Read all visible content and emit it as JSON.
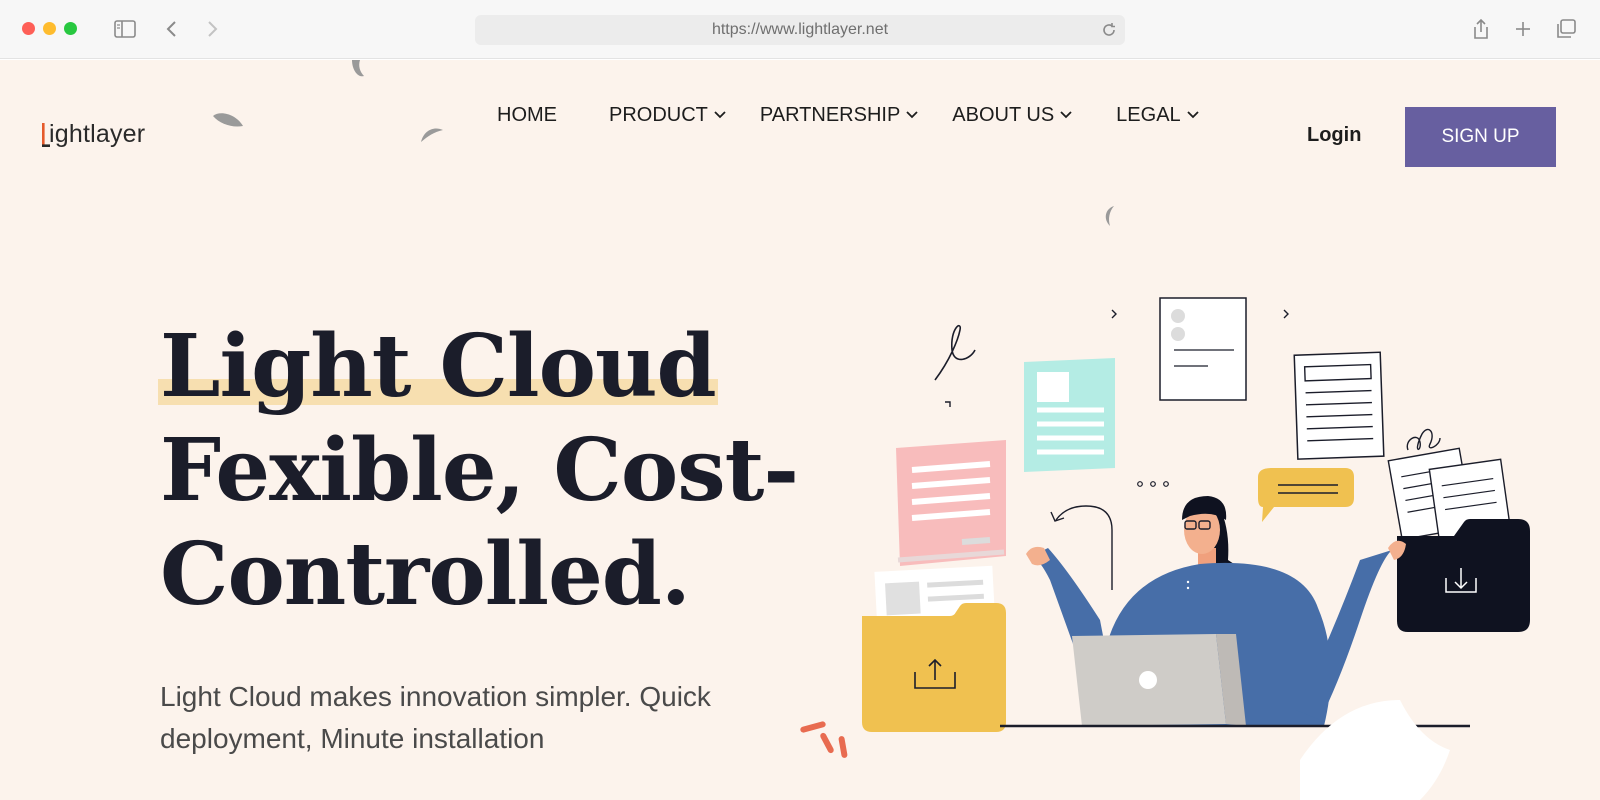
{
  "browser": {
    "url": "https://www.lightlayer.net",
    "icons": [
      "sidebar-icon",
      "back-icon",
      "forward-icon",
      "reload-icon",
      "share-icon",
      "new-tab-icon",
      "tabs-overview-icon"
    ]
  },
  "brand": {
    "logo_text": "lightlayer",
    "accent": "#e55a2b"
  },
  "nav": {
    "items": [
      {
        "label": "HOME",
        "has_dropdown": false
      },
      {
        "label": "PRODUCT",
        "has_dropdown": true
      },
      {
        "label": "PARTNERSHIP",
        "has_dropdown": true
      },
      {
        "label": "ABOUT US",
        "has_dropdown": true
      },
      {
        "label": "LEGAL",
        "has_dropdown": true
      }
    ],
    "login_label": "Login",
    "signup_label": "SIGN UP",
    "signup_color": "#675fa0"
  },
  "hero": {
    "title_line1": "Light Cloud",
    "title_line2": "Fexible, Cost-",
    "title_line3": "Controlled.",
    "subtitle": "Light Cloud makes innovation simpler. Quick deployment, Minute installation",
    "highlight_color": "#f7dfb0",
    "background": "#fcf3ec"
  },
  "illustration": {
    "description_icons": [
      "upload-folder-icon",
      "download-folder-icon",
      "laptop-icon",
      "chat-bubble-icon",
      "document-icon"
    ],
    "colors": {
      "shirt": "#476ea8",
      "folder_yellow": "#f0c150",
      "folder_dark": "#0f1220",
      "doc_pink": "#f8bcbc",
      "doc_teal": "#b4ece4"
    }
  }
}
